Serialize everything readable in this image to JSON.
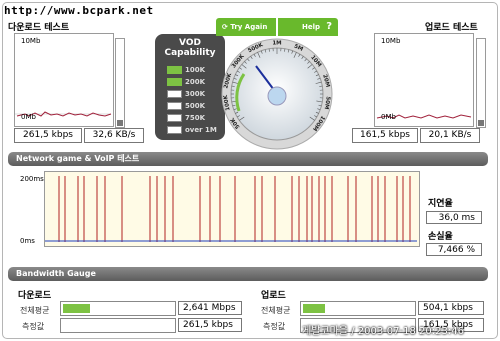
{
  "url": "http://www.bcpark.net",
  "download": {
    "title": "다운로드 테스트",
    "top": "10Mb",
    "bottom": "0Mb",
    "kbps": "261,5 kbps",
    "kBs": "32,6 KB/s"
  },
  "upload": {
    "title": "업로드 테스트",
    "top": "10Mb",
    "bottom": "0Mb",
    "kbps": "161,5 kbps",
    "kBs": "20,1 KB/s"
  },
  "vod": {
    "title1": "VOD",
    "title2": "Capability",
    "items": [
      "100K",
      "200K",
      "300K",
      "500K",
      "750K",
      "over 1M"
    ],
    "active_count": 2
  },
  "buttons": {
    "try_again": "Try Again",
    "help": "Help"
  },
  "gauge": {
    "labels": [
      "50K",
      "100K",
      "200K",
      "300K",
      "500K",
      "1M",
      "5M",
      "10M",
      "20M",
      "50M",
      "100M"
    ]
  },
  "network": {
    "section": "Network game & VoIP 테스트",
    "top": "200ms",
    "bottom": "0ms",
    "latency_label": "지연율",
    "latency": "36,0 ms",
    "loss_label": "손실율",
    "loss": "7,466 %"
  },
  "bandwidth": {
    "section": "Bandwidth Gauge",
    "download": {
      "title": "다운로드",
      "avg_label": "전체평균",
      "avg": "2,641 Mbps",
      "meas_label": "측정값",
      "meas": "261,5 kbps",
      "avg_fraction": 0.25,
      "meas_fraction": 0.0
    },
    "upload": {
      "title": "업로드",
      "avg_label": "전체평균",
      "avg": "504,1 kbps",
      "meas_label": "측정값",
      "meas": "161,5 kbps",
      "avg_fraction": 0.2,
      "meas_fraction": 0.0
    }
  },
  "watermark": "게발코마을 / 2003-07-18 20:23:46",
  "colors": {
    "accent_green": "#69b92c",
    "spike_red": "#b22222",
    "baseline_blue": "#1f3fbf"
  }
}
